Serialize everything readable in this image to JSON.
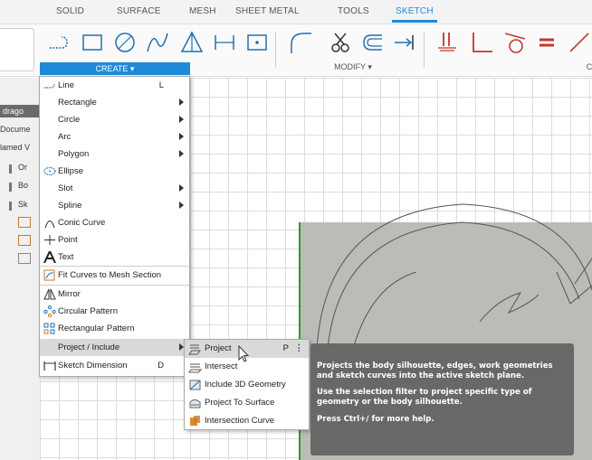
{
  "ribbon": {
    "tabs": [
      "SOLID",
      "SURFACE",
      "MESH",
      "SHEET METAL",
      "TOOLS",
      "SKETCH"
    ],
    "active_tab": "SKETCH",
    "groups": {
      "create": "CREATE ▾",
      "modify": "MODIFY ▾",
      "constrain_partial": "C"
    },
    "accent_color": "#1f8ad9"
  },
  "browser": {
    "doc_tag": "drago",
    "rows": [
      "Docume",
      "lamed V",
      "Or",
      "Bo",
      "Sk"
    ]
  },
  "create_menu": {
    "items": [
      {
        "label": "Line",
        "shortcut": "L",
        "icon": "line-icon"
      },
      {
        "label": "Rectangle",
        "submenu": true
      },
      {
        "label": "Circle",
        "submenu": true
      },
      {
        "label": "Arc",
        "submenu": true
      },
      {
        "label": "Polygon",
        "submenu": true
      },
      {
        "label": "Ellipse",
        "icon": "ellipse-icon"
      },
      {
        "label": "Slot",
        "submenu": true
      },
      {
        "label": "Spline",
        "submenu": true
      },
      {
        "label": "Conic Curve",
        "icon": "conic-curve-icon"
      },
      {
        "label": "Point",
        "icon": "point-icon"
      },
      {
        "label": "Text",
        "icon": "text-icon"
      },
      {
        "label": "Fit Curves to Mesh Section",
        "icon": "fit-curves-icon"
      },
      {
        "label": "Mirror",
        "icon": "mirror-icon"
      },
      {
        "label": "Circular Pattern",
        "icon": "circular-pattern-icon"
      },
      {
        "label": "Rectangular Pattern",
        "icon": "rectangular-pattern-icon"
      },
      {
        "label": "Project / Include",
        "submenu": true
      },
      {
        "label": "Sketch Dimension",
        "shortcut": "D",
        "icon": "sketch-dimension-icon"
      }
    ]
  },
  "project_submenu": {
    "items": [
      {
        "label": "Project",
        "shortcut": "P",
        "more": "⋮",
        "icon": "project-icon"
      },
      {
        "label": "Intersect",
        "icon": "intersect-icon"
      },
      {
        "label": "Include 3D Geometry",
        "icon": "include-3d-geometry-icon"
      },
      {
        "label": "Project To Surface",
        "icon": "project-to-surface-icon"
      },
      {
        "label": "Intersection Curve",
        "icon": "intersection-curve-icon"
      }
    ]
  },
  "tooltip": {
    "line1": "Projects the body silhouette, edges, work geometries and sketch curves into the active sketch plane.",
    "line2": "Use the selection filter to project specific type of geometry or the body silhouette.",
    "line3": "Press Ctrl+/ for more help."
  }
}
